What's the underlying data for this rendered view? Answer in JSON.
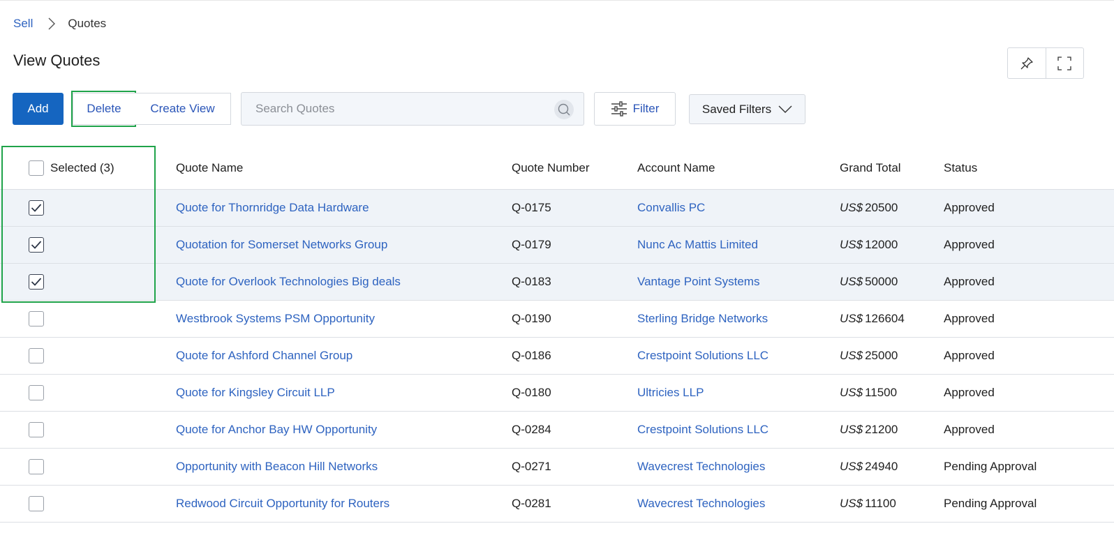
{
  "breadcrumb": {
    "parent": "Sell",
    "current": "Quotes"
  },
  "page": {
    "title": "View Quotes"
  },
  "toolbar": {
    "add_label": "Add",
    "delete_label": "Delete",
    "create_view_label": "Create View",
    "search_placeholder": "Search Quotes",
    "filter_label": "Filter",
    "saved_filters_label": "Saved Filters"
  },
  "colors": {
    "primary": "#1565c0",
    "link": "#2e63c0",
    "highlight": "#1fa34a",
    "selected_row": "#eff3f8"
  },
  "table": {
    "selected_label": "Selected (3)",
    "columns": [
      "Quote Name",
      "Quote Number",
      "Account Name",
      "Grand Total",
      "Status"
    ],
    "rows": [
      {
        "checked": true,
        "name": "Quote for Thornridge Data Hardware",
        "number": "Q-0175",
        "account": "Convallis PC",
        "currency": "US$",
        "total": "20500",
        "status": "Approved"
      },
      {
        "checked": true,
        "name": "Quotation for Somerset Networks Group",
        "number": "Q-0179",
        "account": "Nunc Ac Mattis Limited",
        "currency": "US$",
        "total": "12000",
        "status": "Approved"
      },
      {
        "checked": true,
        "name": "Quote for Overlook Technologies Big deals",
        "number": "Q-0183",
        "account": "Vantage Point Systems",
        "currency": "US$",
        "total": "50000",
        "status": "Approved"
      },
      {
        "checked": false,
        "name": "Westbrook Systems PSM Opportunity",
        "number": "Q-0190",
        "account": "Sterling Bridge Networks",
        "currency": "US$",
        "total": "126604",
        "status": "Approved"
      },
      {
        "checked": false,
        "name": "Quote for Ashford Channel Group",
        "number": "Q-0186",
        "account": "Crestpoint Solutions LLC",
        "currency": "US$",
        "total": "25000",
        "status": "Approved"
      },
      {
        "checked": false,
        "name": "Quote for Kingsley Circuit LLP",
        "number": "Q-0180",
        "account": "Ultricies LLP",
        "currency": "US$",
        "total": "11500",
        "status": "Approved"
      },
      {
        "checked": false,
        "name": "Quote for Anchor Bay HW Opportunity",
        "number": "Q-0284",
        "account": "Crestpoint Solutions LLC",
        "currency": "US$",
        "total": "21200",
        "status": "Approved"
      },
      {
        "checked": false,
        "name": "Opportunity with Beacon Hill Networks",
        "number": "Q-0271",
        "account": "Wavecrest Technologies",
        "currency": "US$",
        "total": "24940",
        "status": "Pending Approval"
      },
      {
        "checked": false,
        "name": "Redwood Circuit Opportunity for Routers",
        "number": "Q-0281",
        "account": "Wavecrest Technologies",
        "currency": "US$",
        "total": "11100",
        "status": "Pending Approval"
      }
    ]
  }
}
